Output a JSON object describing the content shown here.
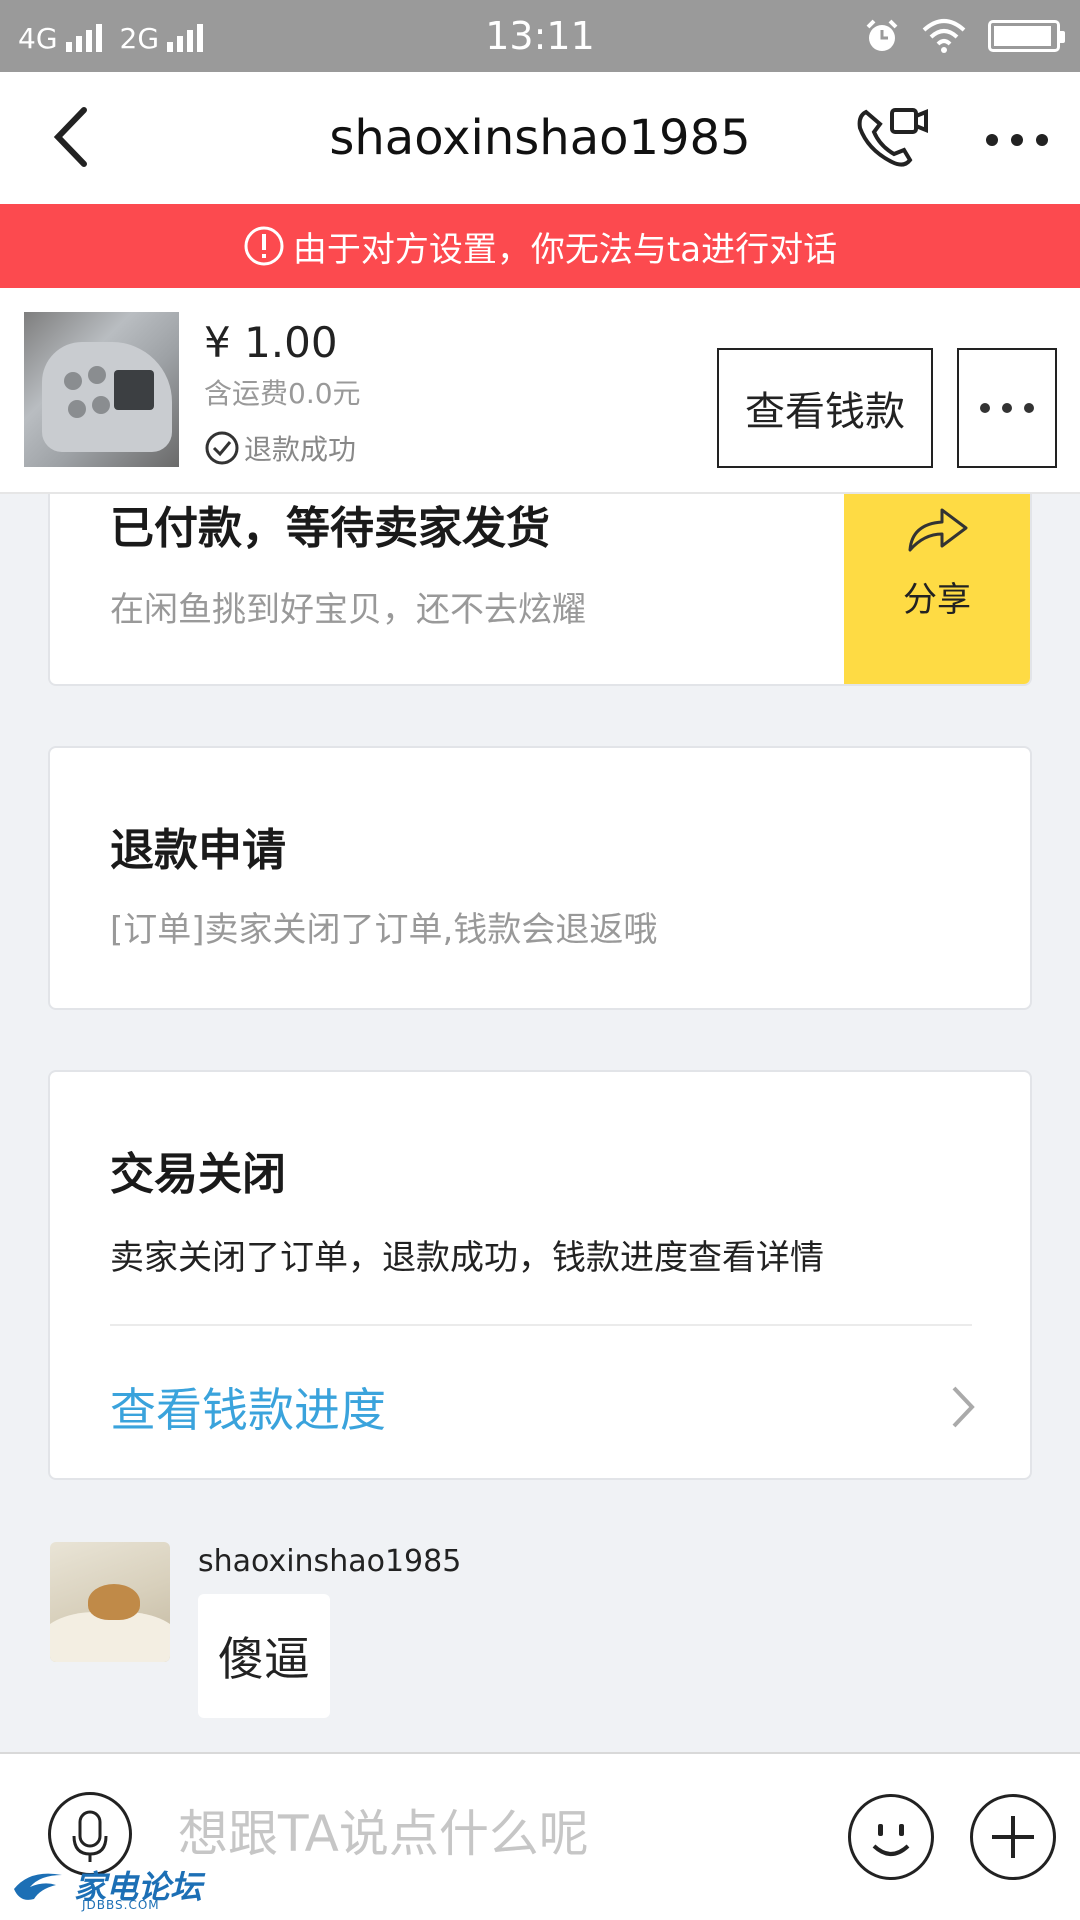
{
  "status_bar": {
    "net1": "4G",
    "net2": "2G",
    "time": "13:11",
    "battery_level": 0.95
  },
  "nav": {
    "title": "shaoxinshao1985",
    "icons": {
      "back": "chevron-left-icon",
      "call": "video-call-icon",
      "more": "more-icon"
    }
  },
  "notice": {
    "text": "由于对方设置，你无法与ta进行对话",
    "color": "#fc4a4f"
  },
  "item": {
    "price": "¥ 1.00",
    "shipping": "含运费0.0元",
    "status": "退款成功",
    "view_money_label": "查看钱款"
  },
  "cards": {
    "paid": {
      "title": "已付款，等待卖家发货",
      "subtitle": "在闲鱼挑到好宝贝，还不去炫耀",
      "share_label": "分享",
      "share_color": "#fedb44"
    },
    "refund": {
      "title": "退款申请",
      "subtitle": "[订单]卖家关闭了订单,钱款会退返哦"
    },
    "closed": {
      "title": "交易关闭",
      "description": "卖家关闭了订单，退款成功，钱款进度查看详情",
      "link_label": "查看钱款进度",
      "link_color": "#3aa3dc"
    }
  },
  "message": {
    "sender": "shaoxinshao1985",
    "text": "傻逼"
  },
  "input": {
    "placeholder": "想跟TA说点什么呢"
  },
  "watermark": {
    "text": "家电论坛",
    "sub": "JDBBS.COM"
  }
}
